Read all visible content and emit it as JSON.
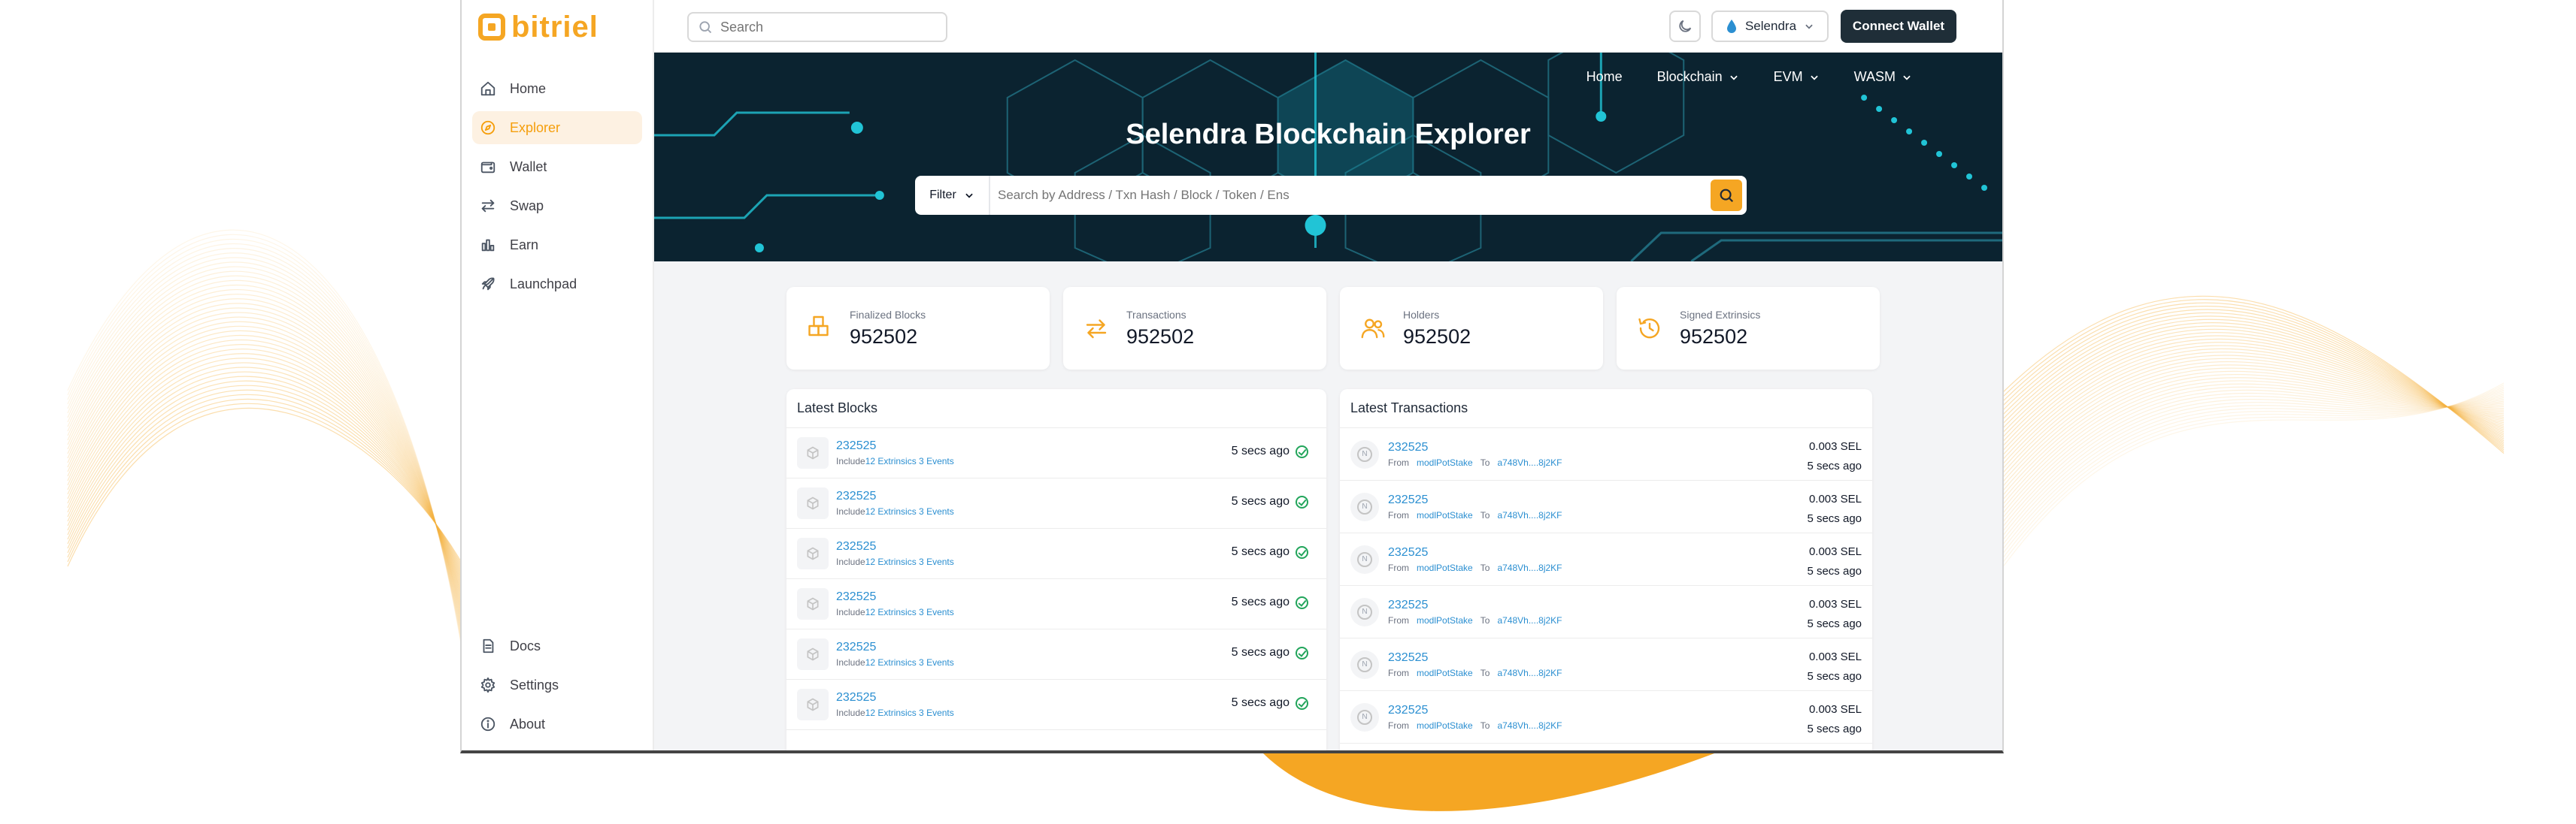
{
  "app": {
    "logo_text": "bitriel",
    "brand_color": "#f5a623"
  },
  "sidebar": {
    "top_items": [
      {
        "label": "Home",
        "icon": "home-icon"
      },
      {
        "label": "Explorer",
        "icon": "compass-icon",
        "active": true
      },
      {
        "label": "Wallet",
        "icon": "wallet-icon"
      },
      {
        "label": "Swap",
        "icon": "swap-icon"
      },
      {
        "label": "Earn",
        "icon": "chart-icon"
      },
      {
        "label": "Launchpad",
        "icon": "rocket-icon"
      }
    ],
    "bottom_items": [
      {
        "label": "Docs",
        "icon": "doc-icon"
      },
      {
        "label": "Settings",
        "icon": "gear-icon"
      },
      {
        "label": "About",
        "icon": "info-icon"
      }
    ]
  },
  "topbar": {
    "search_placeholder": "Search",
    "network": "Selendra",
    "connect_label": "Connect Wallet"
  },
  "hero": {
    "nav": [
      "Home",
      "Blockchain",
      "EVM",
      "WASM"
    ],
    "title": "Selendra Blockchain Explorer",
    "filter_label": "Filter",
    "search_placeholder": "Search by Address / Txn Hash / Block / Token / Ens"
  },
  "stats": [
    {
      "label": "Finalized Blocks",
      "value": "952502",
      "icon": "blocks-icon"
    },
    {
      "label": "Transactions",
      "value": "952502",
      "icon": "transfer-icon"
    },
    {
      "label": "Holders",
      "value": "952502",
      "icon": "users-icon"
    },
    {
      "label": "Signed Extrinsics",
      "value": "952502",
      "icon": "history-icon"
    }
  ],
  "latest_blocks": {
    "title": "Latest Blocks",
    "rows": [
      {
        "number": "232525",
        "include": "Include",
        "detail": "12 Extrinsics 3 Events",
        "time": "5 secs ago"
      },
      {
        "number": "232525",
        "include": "Include",
        "detail": "12 Extrinsics 3 Events",
        "time": "5 secs ago"
      },
      {
        "number": "232525",
        "include": "Include",
        "detail": "12 Extrinsics 3 Events",
        "time": "5 secs ago"
      },
      {
        "number": "232525",
        "include": "Include",
        "detail": "12 Extrinsics 3 Events",
        "time": "5 secs ago"
      },
      {
        "number": "232525",
        "include": "Include",
        "detail": "12 Extrinsics 3 Events",
        "time": "5 secs ago"
      },
      {
        "number": "232525",
        "include": "Include",
        "detail": "12 Extrinsics 3 Events",
        "time": "5 secs ago"
      }
    ]
  },
  "latest_transactions": {
    "title": "Latest Transactions",
    "rows": [
      {
        "hash": "232525",
        "from_label": "From",
        "from": "modlPotStake",
        "to_label": "To",
        "to": "a748Vh....8j2KF",
        "amount": "0.003 SEL",
        "time": "5 secs ago"
      },
      {
        "hash": "232525",
        "from_label": "From",
        "from": "modlPotStake",
        "to_label": "To",
        "to": "a748Vh....8j2KF",
        "amount": "0.003 SEL",
        "time": "5 secs ago"
      },
      {
        "hash": "232525",
        "from_label": "From",
        "from": "modlPotStake",
        "to_label": "To",
        "to": "a748Vh....8j2KF",
        "amount": "0.003 SEL",
        "time": "5 secs ago"
      },
      {
        "hash": "232525",
        "from_label": "From",
        "from": "modlPotStake",
        "to_label": "To",
        "to": "a748Vh....8j2KF",
        "amount": "0.003 SEL",
        "time": "5 secs ago"
      },
      {
        "hash": "232525",
        "from_label": "From",
        "from": "modlPotStake",
        "to_label": "To",
        "to": "a748Vh....8j2KF",
        "amount": "0.003 SEL",
        "time": "5 secs ago"
      },
      {
        "hash": "232525",
        "from_label": "From",
        "from": "modlPotStake",
        "to_label": "To",
        "to": "a748Vh....8j2KF",
        "amount": "0.003 SEL",
        "time": "5 secs ago"
      }
    ]
  }
}
